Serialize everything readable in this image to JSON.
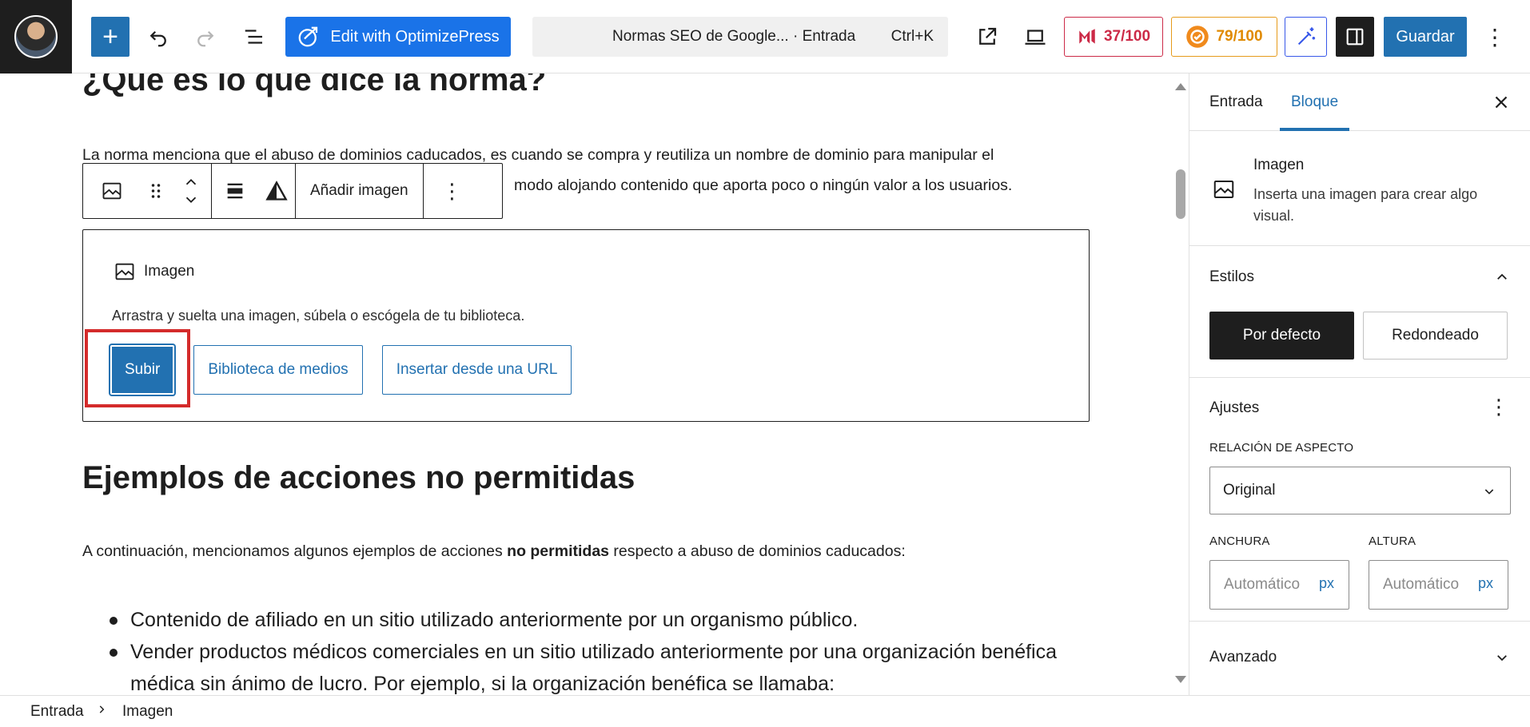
{
  "topbar": {
    "op_label": "Edit with OptimizePress",
    "command_title": "Normas SEO de Google... · Entrada",
    "command_shortcut": "Ctrl+K",
    "score_a": "37/100",
    "score_b": "79/100",
    "save_label": "Guardar",
    "colors": {
      "primary": "#2271b1",
      "optimizepress": "#1a73e8",
      "score_a": "#cc2a47",
      "score_b": "#e08a00",
      "ai": "#3858e9"
    }
  },
  "content": {
    "heading_top": "¿Qué es lo que dice la norma?",
    "para1_line1": "La norma menciona que el abuso de dominios caducados, es cuando se compra y reutiliza un nombre de dominio para manipular el",
    "para1_line2": "modo alojando contenido que aporta poco o ningún valor a los usuarios.",
    "block_toolbar": {
      "add_image": "Añadir imagen"
    },
    "image_block": {
      "label": "Imagen",
      "description": "Arrastra y suelta una imagen, súbela o escógela de tu biblioteca.",
      "upload": "Subir",
      "media_library": "Biblioteca de medios",
      "insert_url": "Insertar desde una URL"
    },
    "heading_examples": "Ejemplos de acciones no permitidas",
    "para2_before": "A continuación, mencionamos algunos ejemplos de acciones ",
    "para2_bold": "no permitidas",
    "para2_after": " respecto a abuso de dominios caducados:",
    "list": [
      "Contenido de afiliado en un sitio utilizado anteriormente por un organismo público.",
      "Vender productos médicos comerciales en un sitio utilizado anteriormente por una organización benéfica médica sin ánimo de lucro. Por ejemplo, si la organización benéfica se llamaba:"
    ]
  },
  "sidebar": {
    "tabs": [
      "Entrada",
      "Bloque"
    ],
    "active_tab": "Bloque",
    "card_title": "Imagen",
    "card_desc": "Inserta una imagen para crear algo visual.",
    "styles_title": "Estilos",
    "style_default": "Por defecto",
    "style_rounded": "Redondeado",
    "settings_title": "Ajustes",
    "aspect_label": "Relación de aspecto",
    "aspect_value": "Original",
    "width_label": "Anchura",
    "height_label": "Altura",
    "width_placeholder": "Automático",
    "height_placeholder": "Automático",
    "unit": "px",
    "advanced_title": "Avanzado"
  },
  "statusbar": {
    "crumbs": [
      "Entrada",
      "Imagen"
    ]
  }
}
